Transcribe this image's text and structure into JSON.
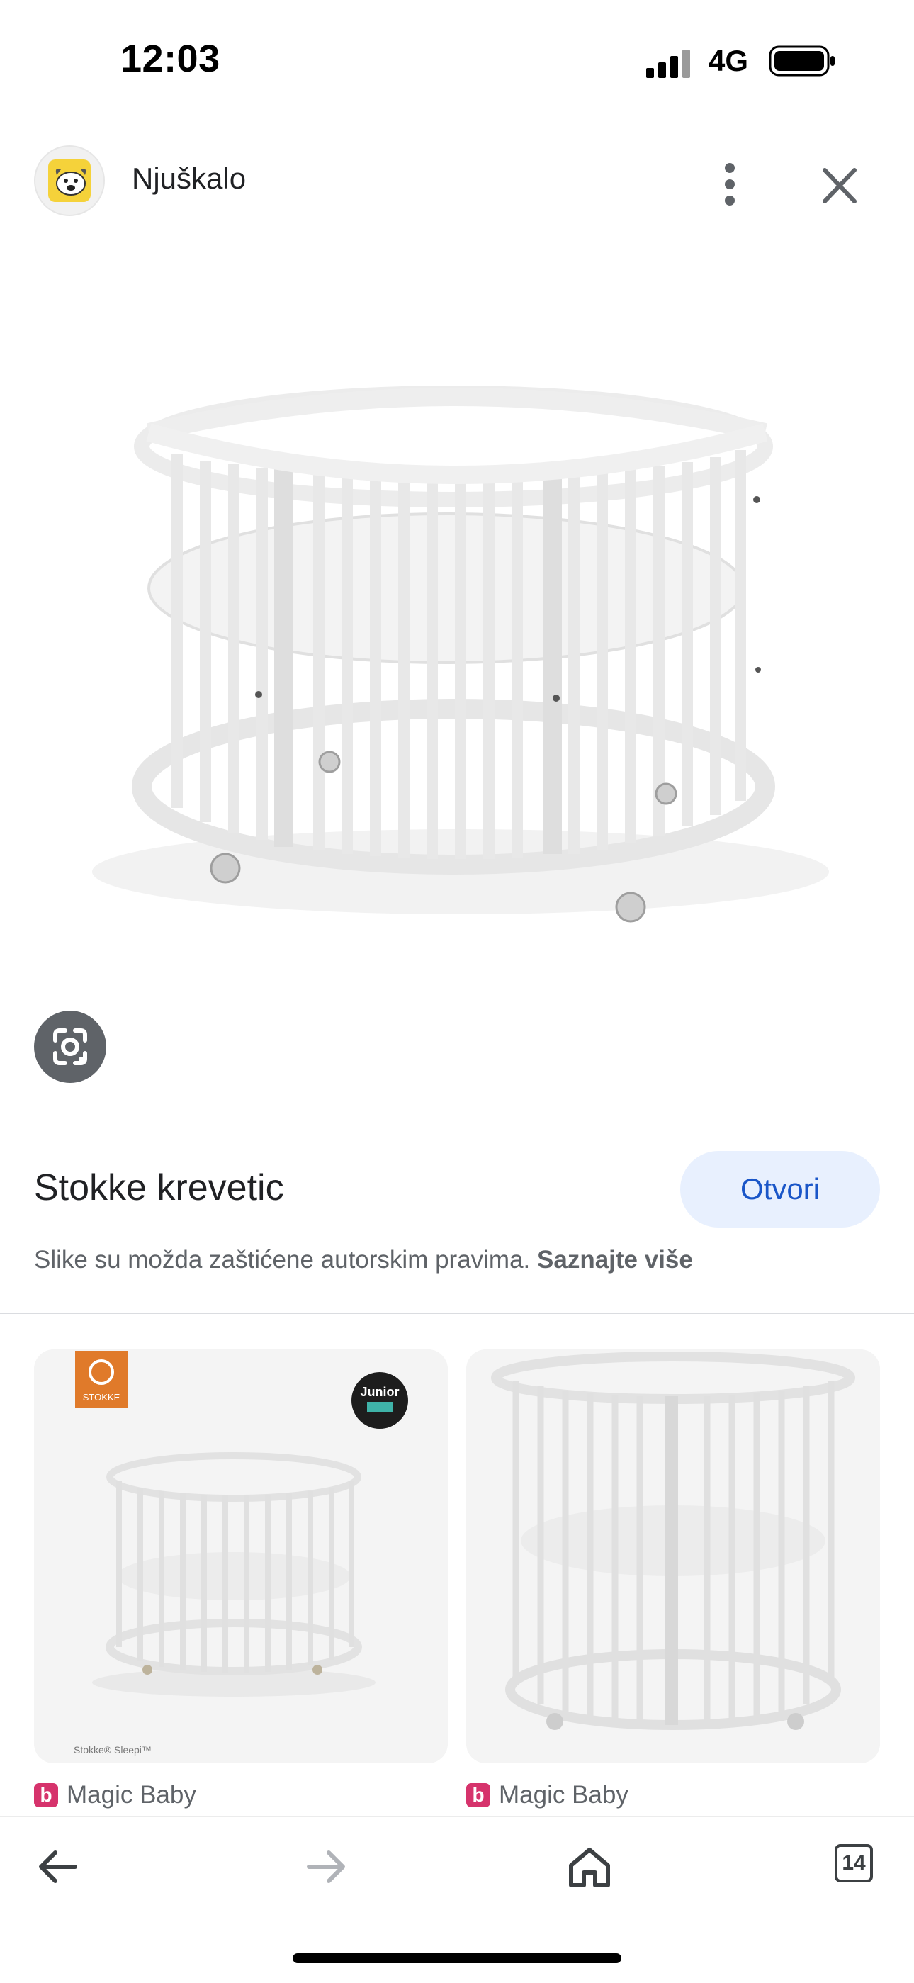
{
  "status_bar": {
    "time": "12:03",
    "network": "4G"
  },
  "header": {
    "source_name": "Njuškalo"
  },
  "result": {
    "title": "Stokke krevetic",
    "open_label": "Otvori",
    "copyright_text": "Slike su možda zaštićene autorskim pravima.",
    "learn_more": "Saznajte više"
  },
  "related": [
    {
      "site": "Magic Baby",
      "site_icon": "b",
      "brand_badge": "STOKKE",
      "award_badge": "Junior",
      "caption": "Stokke® Sleepi™"
    },
    {
      "site": "Magic Baby",
      "site_icon": "b"
    }
  ],
  "toolbar": {
    "tab_count": "14"
  },
  "colors": {
    "accent": "#1a56c8",
    "open_button_bg": "#e8f0fe",
    "site_icon": "#d6336c"
  }
}
